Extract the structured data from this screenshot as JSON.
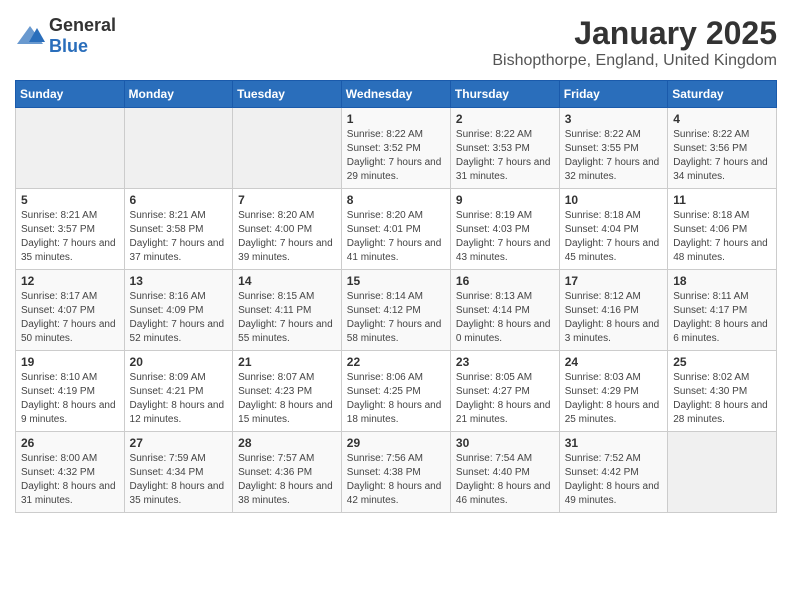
{
  "logo": {
    "general": "General",
    "blue": "Blue"
  },
  "title": "January 2025",
  "subtitle": "Bishopthorpe, England, United Kingdom",
  "weekdays": [
    "Sunday",
    "Monday",
    "Tuesday",
    "Wednesday",
    "Thursday",
    "Friday",
    "Saturday"
  ],
  "weeks": [
    [
      {
        "day": "",
        "sunrise": "",
        "sunset": "",
        "daylight": ""
      },
      {
        "day": "",
        "sunrise": "",
        "sunset": "",
        "daylight": ""
      },
      {
        "day": "",
        "sunrise": "",
        "sunset": "",
        "daylight": ""
      },
      {
        "day": "1",
        "sunrise": "Sunrise: 8:22 AM",
        "sunset": "Sunset: 3:52 PM",
        "daylight": "Daylight: 7 hours and 29 minutes."
      },
      {
        "day": "2",
        "sunrise": "Sunrise: 8:22 AM",
        "sunset": "Sunset: 3:53 PM",
        "daylight": "Daylight: 7 hours and 31 minutes."
      },
      {
        "day": "3",
        "sunrise": "Sunrise: 8:22 AM",
        "sunset": "Sunset: 3:55 PM",
        "daylight": "Daylight: 7 hours and 32 minutes."
      },
      {
        "day": "4",
        "sunrise": "Sunrise: 8:22 AM",
        "sunset": "Sunset: 3:56 PM",
        "daylight": "Daylight: 7 hours and 34 minutes."
      }
    ],
    [
      {
        "day": "5",
        "sunrise": "Sunrise: 8:21 AM",
        "sunset": "Sunset: 3:57 PM",
        "daylight": "Daylight: 7 hours and 35 minutes."
      },
      {
        "day": "6",
        "sunrise": "Sunrise: 8:21 AM",
        "sunset": "Sunset: 3:58 PM",
        "daylight": "Daylight: 7 hours and 37 minutes."
      },
      {
        "day": "7",
        "sunrise": "Sunrise: 8:20 AM",
        "sunset": "Sunset: 4:00 PM",
        "daylight": "Daylight: 7 hours and 39 minutes."
      },
      {
        "day": "8",
        "sunrise": "Sunrise: 8:20 AM",
        "sunset": "Sunset: 4:01 PM",
        "daylight": "Daylight: 7 hours and 41 minutes."
      },
      {
        "day": "9",
        "sunrise": "Sunrise: 8:19 AM",
        "sunset": "Sunset: 4:03 PM",
        "daylight": "Daylight: 7 hours and 43 minutes."
      },
      {
        "day": "10",
        "sunrise": "Sunrise: 8:18 AM",
        "sunset": "Sunset: 4:04 PM",
        "daylight": "Daylight: 7 hours and 45 minutes."
      },
      {
        "day": "11",
        "sunrise": "Sunrise: 8:18 AM",
        "sunset": "Sunset: 4:06 PM",
        "daylight": "Daylight: 7 hours and 48 minutes."
      }
    ],
    [
      {
        "day": "12",
        "sunrise": "Sunrise: 8:17 AM",
        "sunset": "Sunset: 4:07 PM",
        "daylight": "Daylight: 7 hours and 50 minutes."
      },
      {
        "day": "13",
        "sunrise": "Sunrise: 8:16 AM",
        "sunset": "Sunset: 4:09 PM",
        "daylight": "Daylight: 7 hours and 52 minutes."
      },
      {
        "day": "14",
        "sunrise": "Sunrise: 8:15 AM",
        "sunset": "Sunset: 4:11 PM",
        "daylight": "Daylight: 7 hours and 55 minutes."
      },
      {
        "day": "15",
        "sunrise": "Sunrise: 8:14 AM",
        "sunset": "Sunset: 4:12 PM",
        "daylight": "Daylight: 7 hours and 58 minutes."
      },
      {
        "day": "16",
        "sunrise": "Sunrise: 8:13 AM",
        "sunset": "Sunset: 4:14 PM",
        "daylight": "Daylight: 8 hours and 0 minutes."
      },
      {
        "day": "17",
        "sunrise": "Sunrise: 8:12 AM",
        "sunset": "Sunset: 4:16 PM",
        "daylight": "Daylight: 8 hours and 3 minutes."
      },
      {
        "day": "18",
        "sunrise": "Sunrise: 8:11 AM",
        "sunset": "Sunset: 4:17 PM",
        "daylight": "Daylight: 8 hours and 6 minutes."
      }
    ],
    [
      {
        "day": "19",
        "sunrise": "Sunrise: 8:10 AM",
        "sunset": "Sunset: 4:19 PM",
        "daylight": "Daylight: 8 hours and 9 minutes."
      },
      {
        "day": "20",
        "sunrise": "Sunrise: 8:09 AM",
        "sunset": "Sunset: 4:21 PM",
        "daylight": "Daylight: 8 hours and 12 minutes."
      },
      {
        "day": "21",
        "sunrise": "Sunrise: 8:07 AM",
        "sunset": "Sunset: 4:23 PM",
        "daylight": "Daylight: 8 hours and 15 minutes."
      },
      {
        "day": "22",
        "sunrise": "Sunrise: 8:06 AM",
        "sunset": "Sunset: 4:25 PM",
        "daylight": "Daylight: 8 hours and 18 minutes."
      },
      {
        "day": "23",
        "sunrise": "Sunrise: 8:05 AM",
        "sunset": "Sunset: 4:27 PM",
        "daylight": "Daylight: 8 hours and 21 minutes."
      },
      {
        "day": "24",
        "sunrise": "Sunrise: 8:03 AM",
        "sunset": "Sunset: 4:29 PM",
        "daylight": "Daylight: 8 hours and 25 minutes."
      },
      {
        "day": "25",
        "sunrise": "Sunrise: 8:02 AM",
        "sunset": "Sunset: 4:30 PM",
        "daylight": "Daylight: 8 hours and 28 minutes."
      }
    ],
    [
      {
        "day": "26",
        "sunrise": "Sunrise: 8:00 AM",
        "sunset": "Sunset: 4:32 PM",
        "daylight": "Daylight: 8 hours and 31 minutes."
      },
      {
        "day": "27",
        "sunrise": "Sunrise: 7:59 AM",
        "sunset": "Sunset: 4:34 PM",
        "daylight": "Daylight: 8 hours and 35 minutes."
      },
      {
        "day": "28",
        "sunrise": "Sunrise: 7:57 AM",
        "sunset": "Sunset: 4:36 PM",
        "daylight": "Daylight: 8 hours and 38 minutes."
      },
      {
        "day": "29",
        "sunrise": "Sunrise: 7:56 AM",
        "sunset": "Sunset: 4:38 PM",
        "daylight": "Daylight: 8 hours and 42 minutes."
      },
      {
        "day": "30",
        "sunrise": "Sunrise: 7:54 AM",
        "sunset": "Sunset: 4:40 PM",
        "daylight": "Daylight: 8 hours and 46 minutes."
      },
      {
        "day": "31",
        "sunrise": "Sunrise: 7:52 AM",
        "sunset": "Sunset: 4:42 PM",
        "daylight": "Daylight: 8 hours and 49 minutes."
      },
      {
        "day": "",
        "sunrise": "",
        "sunset": "",
        "daylight": ""
      }
    ]
  ]
}
